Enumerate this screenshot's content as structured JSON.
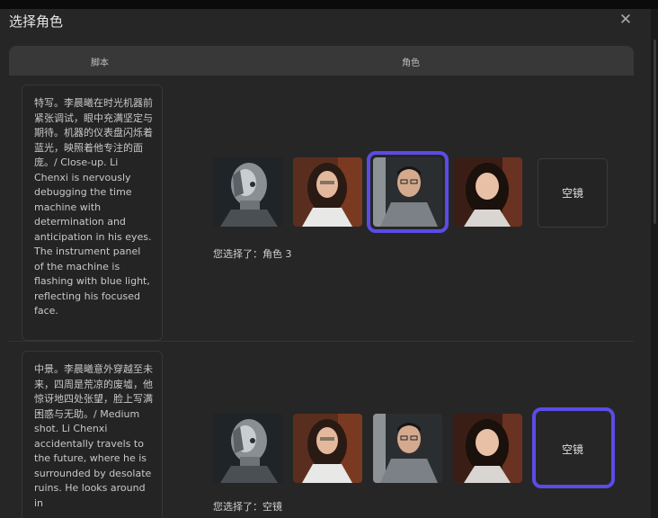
{
  "dialog": {
    "title": "选择角色",
    "close_icon": "close-icon"
  },
  "table": {
    "headers": {
      "script": "脚本",
      "role": "角色"
    },
    "rows": [
      {
        "script": "特写。李晨曦在时光机器前紧张调试，眼中充满坚定与期待。机器的仪表盘闪烁着蓝光，映照着他专注的面庞。/ Close-up. Li Chenxi is nervously debugging the time machine with determination and anticipation in his eyes. The instrument panel of the machine is flashing with blue light, reflecting his focused face.",
        "candidates": [
          "robot",
          "woman",
          "man",
          "girl"
        ],
        "empty_label": "空镜",
        "selection_text": "您选择了：角色 3",
        "selected": "man"
      },
      {
        "script": "中景。李晨曦意外穿越至未来，四周是荒凉的废墟，他惊讶地四处张望，脸上写满困惑与无助。/ Medium shot. Li Chenxi accidentally travels to the future, where he is surrounded by desolate ruins. He looks around in",
        "candidates": [
          "robot",
          "woman",
          "man",
          "girl"
        ],
        "empty_label": "空镜",
        "selection_text": "您选择了：空镜",
        "selected": "empty"
      }
    ]
  },
  "colors": {
    "accent": "#5b4ce6",
    "background": "#262626",
    "header": "#383838"
  }
}
